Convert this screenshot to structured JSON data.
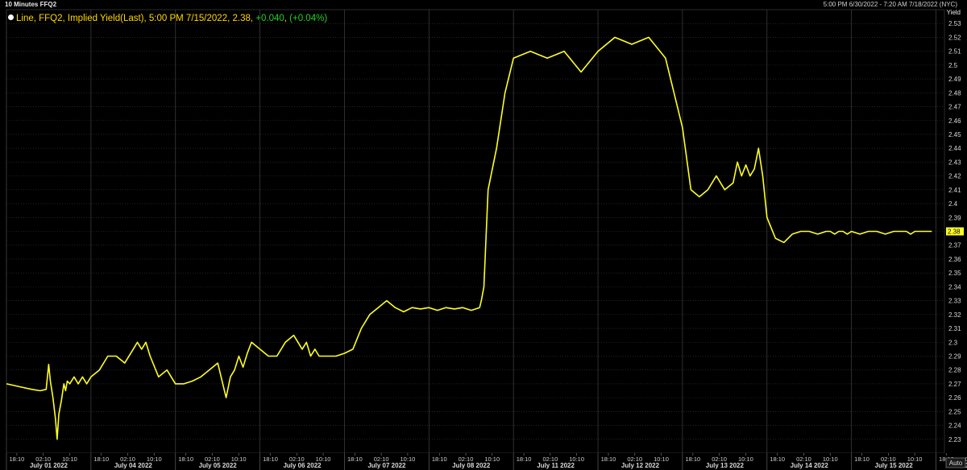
{
  "header": {
    "left_title": "10 Minutes FFQ2",
    "right_range": "5:00 PM 6/30/2022 - 7:20 AM 7/18/2022 (NYC)"
  },
  "legend": {
    "series_text": "Line, FFQ2, Implied Yield(Last), 5:00 PM 7/15/2022, 2.38,",
    "change_abs": "+0.040",
    "change_pct": "(+0.04%)"
  },
  "yaxis_title": "Yield",
  "auto_label": "Auto",
  "colors": {
    "background": "#000000",
    "line": "#ffff22",
    "grid": "#3a3a3a",
    "last_label_bg": "#ffff22",
    "change_positive": "#22d422"
  },
  "chart_data": {
    "type": "line",
    "title": "Line, FFQ2, Implied Yield(Last)",
    "ylabel": "Yield",
    "ylim": [
      2.22,
      2.54
    ],
    "yticks": [
      2.23,
      2.24,
      2.25,
      2.26,
      2.27,
      2.28,
      2.29,
      2.3,
      2.31,
      2.32,
      2.33,
      2.34,
      2.35,
      2.36,
      2.37,
      2.38,
      2.39,
      2.4,
      2.41,
      2.42,
      2.43,
      2.44,
      2.45,
      2.46,
      2.47,
      2.48,
      2.49,
      2.5,
      2.51,
      2.52,
      2.53
    ],
    "last_value": 2.38,
    "grid": true,
    "days": [
      {
        "date": "July 01 2022",
        "times": [
          "18:10",
          "02:10",
          "10:10"
        ]
      },
      {
        "date": "July 04 2022",
        "times": [
          "18:10",
          "02:10",
          "10:10"
        ]
      },
      {
        "date": "July 05 2022",
        "times": [
          "18:10",
          "02:10",
          "10:10"
        ]
      },
      {
        "date": "July 06 2022",
        "times": [
          "18:10",
          "02:10",
          "10:10"
        ]
      },
      {
        "date": "July 07 2022",
        "times": [
          "18:10",
          "02:10",
          "10:10"
        ]
      },
      {
        "date": "July 08 2022",
        "times": [
          "18:10",
          "02:10",
          "10:10"
        ]
      },
      {
        "date": "July 11 2022",
        "times": [
          "18:10",
          "02:10",
          "10:10"
        ]
      },
      {
        "date": "July 12 2022",
        "times": [
          "18:10",
          "02:10",
          "10:10"
        ]
      },
      {
        "date": "July 13 2022",
        "times": [
          "18:10",
          "02:10",
          "10:10"
        ]
      },
      {
        "date": "July 14 2022",
        "times": [
          "18:10",
          "02:10",
          "10:10"
        ]
      },
      {
        "date": "July 15 2022",
        "times": [
          "18:10",
          "02:10",
          "10:10"
        ]
      },
      {
        "date": "Jul 18 22",
        "times": [
          "18:10",
          "02:10"
        ]
      }
    ],
    "series": [
      {
        "x": [
          0,
          0.15,
          0.3,
          0.4,
          0.47,
          0.5,
          0.52,
          0.55,
          0.58,
          0.6,
          0.62,
          0.65,
          0.68,
          0.7,
          0.72,
          0.75,
          0.8,
          0.85,
          0.9,
          0.95,
          1.0,
          1.1,
          1.2,
          1.3,
          1.4,
          1.5,
          1.55,
          1.6,
          1.65,
          1.7,
          1.8,
          1.9,
          2.0,
          2.1,
          2.2,
          2.3,
          2.4,
          2.5,
          2.6,
          2.65,
          2.7,
          2.75,
          2.8,
          2.85,
          2.9,
          3.0,
          3.1,
          3.2,
          3.3,
          3.4,
          3.5,
          3.55,
          3.6,
          3.65,
          3.7,
          3.8,
          3.9,
          4.0,
          4.1,
          4.2,
          4.3,
          4.4,
          4.5,
          4.6,
          4.7,
          4.8,
          4.9,
          5.0,
          5.1,
          5.2,
          5.3,
          5.4,
          5.5,
          5.6,
          5.62,
          5.65,
          5.7,
          5.8,
          5.9,
          6.0,
          6.2,
          6.4,
          6.6,
          6.8,
          7.0,
          7.2,
          7.4,
          7.6,
          7.8,
          8.0,
          8.1,
          8.2,
          8.3,
          8.4,
          8.5,
          8.6,
          8.65,
          8.7,
          8.75,
          8.8,
          8.85,
          8.9,
          8.95,
          9.0,
          9.1,
          9.2,
          9.3,
          9.4,
          9.5,
          9.6,
          9.7,
          9.75,
          9.8,
          9.85,
          9.9,
          9.95,
          10.0,
          10.1,
          10.2,
          10.3,
          10.4,
          10.5,
          10.6,
          10.65,
          10.7,
          10.75,
          10.8,
          10.85,
          10.9,
          10.95
        ],
        "values": [
          2.27,
          2.268,
          2.266,
          2.265,
          2.266,
          2.284,
          2.272,
          2.26,
          2.245,
          2.23,
          2.248,
          2.258,
          2.27,
          2.265,
          2.272,
          2.27,
          2.275,
          2.27,
          2.275,
          2.27,
          2.275,
          2.28,
          2.29,
          2.29,
          2.285,
          2.295,
          2.3,
          2.295,
          2.3,
          2.29,
          2.275,
          2.28,
          2.27,
          2.27,
          2.272,
          2.275,
          2.28,
          2.285,
          2.26,
          2.275,
          2.28,
          2.29,
          2.282,
          2.292,
          2.3,
          2.295,
          2.29,
          2.29,
          2.3,
          2.305,
          2.295,
          2.3,
          2.29,
          2.295,
          2.29,
          2.29,
          2.29,
          2.292,
          2.295,
          2.31,
          2.32,
          2.325,
          2.33,
          2.325,
          2.322,
          2.325,
          2.324,
          2.325,
          2.323,
          2.325,
          2.324,
          2.325,
          2.323,
          2.325,
          2.33,
          2.34,
          2.41,
          2.44,
          2.48,
          2.505,
          2.51,
          2.505,
          2.51,
          2.495,
          2.51,
          2.52,
          2.515,
          2.52,
          2.505,
          2.455,
          2.41,
          2.405,
          2.41,
          2.42,
          2.41,
          2.415,
          2.43,
          2.42,
          2.428,
          2.42,
          2.425,
          2.44,
          2.42,
          2.39,
          2.375,
          2.372,
          2.378,
          2.38,
          2.38,
          2.378,
          2.38,
          2.38,
          2.378,
          2.38,
          2.38,
          2.378,
          2.38,
          2.378,
          2.38,
          2.38,
          2.378,
          2.38,
          2.38,
          2.38,
          2.378,
          2.38,
          2.38,
          2.38,
          2.38,
          2.38
        ]
      }
    ]
  }
}
